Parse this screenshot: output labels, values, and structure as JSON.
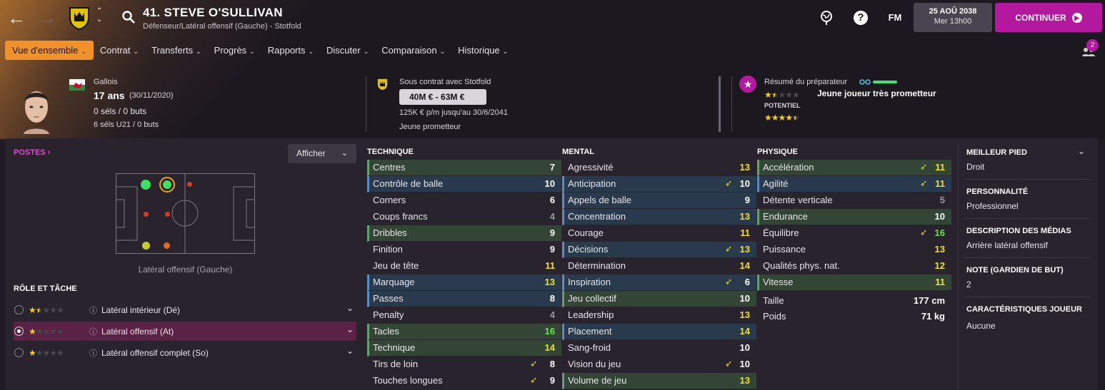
{
  "header": {
    "player_title": "41. STEVE O'SULLIVAN",
    "subtitle": "Défenseur/Latéral offensif (Gauche) - Stotfold",
    "fm_label": "FM",
    "date": "25 AOÛ 2038",
    "time": "Mer 13h00",
    "continue_label": "CONTINUER",
    "notif_count": "2"
  },
  "menu": [
    {
      "label": "Vue d'ensemble",
      "active": true
    },
    {
      "label": "Contrat"
    },
    {
      "label": "Transferts"
    },
    {
      "label": "Progrès"
    },
    {
      "label": "Rapports"
    },
    {
      "label": "Discuter"
    },
    {
      "label": "Comparaison"
    },
    {
      "label": "Historique"
    }
  ],
  "info": {
    "nationality": "Gallois",
    "age": "17 ans",
    "dob": "(30/11/2020)",
    "caps": "0 séls / 0 buts",
    "u21": "6 séls U21 / 0 buts",
    "contract_with": "Sous contrat avec Stotfold",
    "value": "40M € - 63M €",
    "wage": "125K € p/m jusqu'au 30/6/2041",
    "status": "Jeune prometteur",
    "coach_summary": "Résumé du préparateur",
    "coach_verdict": "Jeune joueur très prometteur",
    "potential_label": "POTENTIEL",
    "current_stars": 1.5,
    "potential_stars": 4.5
  },
  "positions": {
    "title": "POSTES",
    "afficher": "Afficher",
    "selected_position": "Latéral offensif (Gauche)"
  },
  "roles": {
    "title": "RÔLE ET TÂCHE",
    "items": [
      {
        "name": "Latéral intérieur (Dé)",
        "stars": 1.5
      },
      {
        "name": "Latéral offensif (At)",
        "stars": 1,
        "selected": true
      },
      {
        "name": "Latéral offensif complet (So)",
        "stars": 1
      }
    ]
  },
  "attributes": {
    "technique": {
      "title": "TECHNIQUE",
      "rows": [
        {
          "name": "Centres",
          "value": "7",
          "hl": "g",
          "c": "w"
        },
        {
          "name": "Contrôle de balle",
          "value": "10",
          "hl": "b",
          "c": "w"
        },
        {
          "name": "Corners",
          "value": "6",
          "c": "w"
        },
        {
          "name": "Coups francs",
          "value": "4",
          "c": "gr"
        },
        {
          "name": "Dribbles",
          "value": "9",
          "hl": "g",
          "c": "w"
        },
        {
          "name": "Finition",
          "value": "9",
          "c": "w"
        },
        {
          "name": "Jeu de tête",
          "value": "11",
          "c": "y"
        },
        {
          "name": "Marquage",
          "value": "13",
          "hl": "b",
          "c": "y"
        },
        {
          "name": "Passes",
          "value": "8",
          "hl": "b",
          "c": "w"
        },
        {
          "name": "Penalty",
          "value": "4",
          "c": "gr"
        },
        {
          "name": "Tacles",
          "value": "16",
          "hl": "g",
          "c": "gn"
        },
        {
          "name": "Technique",
          "value": "14",
          "hl": "g",
          "c": "y"
        },
        {
          "name": "Tirs de loin",
          "value": "8",
          "c": "w",
          "trend": true
        },
        {
          "name": "Touches longues",
          "value": "9",
          "c": "w",
          "trend": true
        }
      ]
    },
    "mental": {
      "title": "MENTAL",
      "rows": [
        {
          "name": "Agressivité",
          "value": "13",
          "c": "y"
        },
        {
          "name": "Anticipation",
          "value": "10",
          "hl": "b",
          "c": "w",
          "trend": true
        },
        {
          "name": "Appels de balle",
          "value": "9",
          "hl": "b",
          "c": "w"
        },
        {
          "name": "Concentration",
          "value": "13",
          "hl": "b",
          "c": "y"
        },
        {
          "name": "Courage",
          "value": "11",
          "c": "y"
        },
        {
          "name": "Décisions",
          "value": "13",
          "hl": "b",
          "c": "y",
          "trend": true
        },
        {
          "name": "Détermination",
          "value": "14",
          "c": "y"
        },
        {
          "name": "Inspiration",
          "value": "6",
          "hl": "b",
          "c": "w",
          "trend": true
        },
        {
          "name": "Jeu collectif",
          "value": "10",
          "hl": "g",
          "c": "w"
        },
        {
          "name": "Leadership",
          "value": "13",
          "c": "y"
        },
        {
          "name": "Placement",
          "value": "14",
          "hl": "b",
          "c": "y"
        },
        {
          "name": "Sang-froid",
          "value": "10",
          "c": "w"
        },
        {
          "name": "Vision du jeu",
          "value": "10",
          "c": "w",
          "trend": true
        },
        {
          "name": "Volume de jeu",
          "value": "13",
          "hl": "g",
          "c": "y"
        }
      ]
    },
    "physique": {
      "title": "PHYSIQUE",
      "rows": [
        {
          "name": "Accélération",
          "value": "11",
          "hl": "g",
          "c": "y",
          "trend": true
        },
        {
          "name": "Agilité",
          "value": "11",
          "hl": "b",
          "c": "y",
          "trend": true
        },
        {
          "name": "Détente verticale",
          "value": "5",
          "c": "gr"
        },
        {
          "name": "Endurance",
          "value": "10",
          "hl": "g",
          "c": "w"
        },
        {
          "name": "Équilibre",
          "value": "16",
          "c": "gn",
          "trend": true
        },
        {
          "name": "Puissance",
          "value": "13",
          "c": "y"
        },
        {
          "name": "Qualités phys. nat.",
          "value": "12",
          "c": "y"
        },
        {
          "name": "Vitesse",
          "value": "11",
          "hl": "g",
          "c": "y"
        }
      ],
      "height_label": "Taille",
      "height": "177 cm",
      "weight_label": "Poids",
      "weight": "71 kg"
    }
  },
  "right_panel": [
    {
      "label": "MEILLEUR PIED",
      "value": "Droit"
    },
    {
      "label": "PERSONNALITÉ",
      "value": "Professionnel"
    },
    {
      "label": "DESCRIPTION DES MÉDIAS",
      "value": "Arrière latéral offensif"
    },
    {
      "label": "NOTE (GARDIEN DE BUT)",
      "value": "2"
    },
    {
      "label": "CARACTÉRISTIQUES JOUEUR",
      "value": "Aucune"
    }
  ],
  "colors": {
    "accent": "#b3189f",
    "active_tab": "#f0912a"
  }
}
